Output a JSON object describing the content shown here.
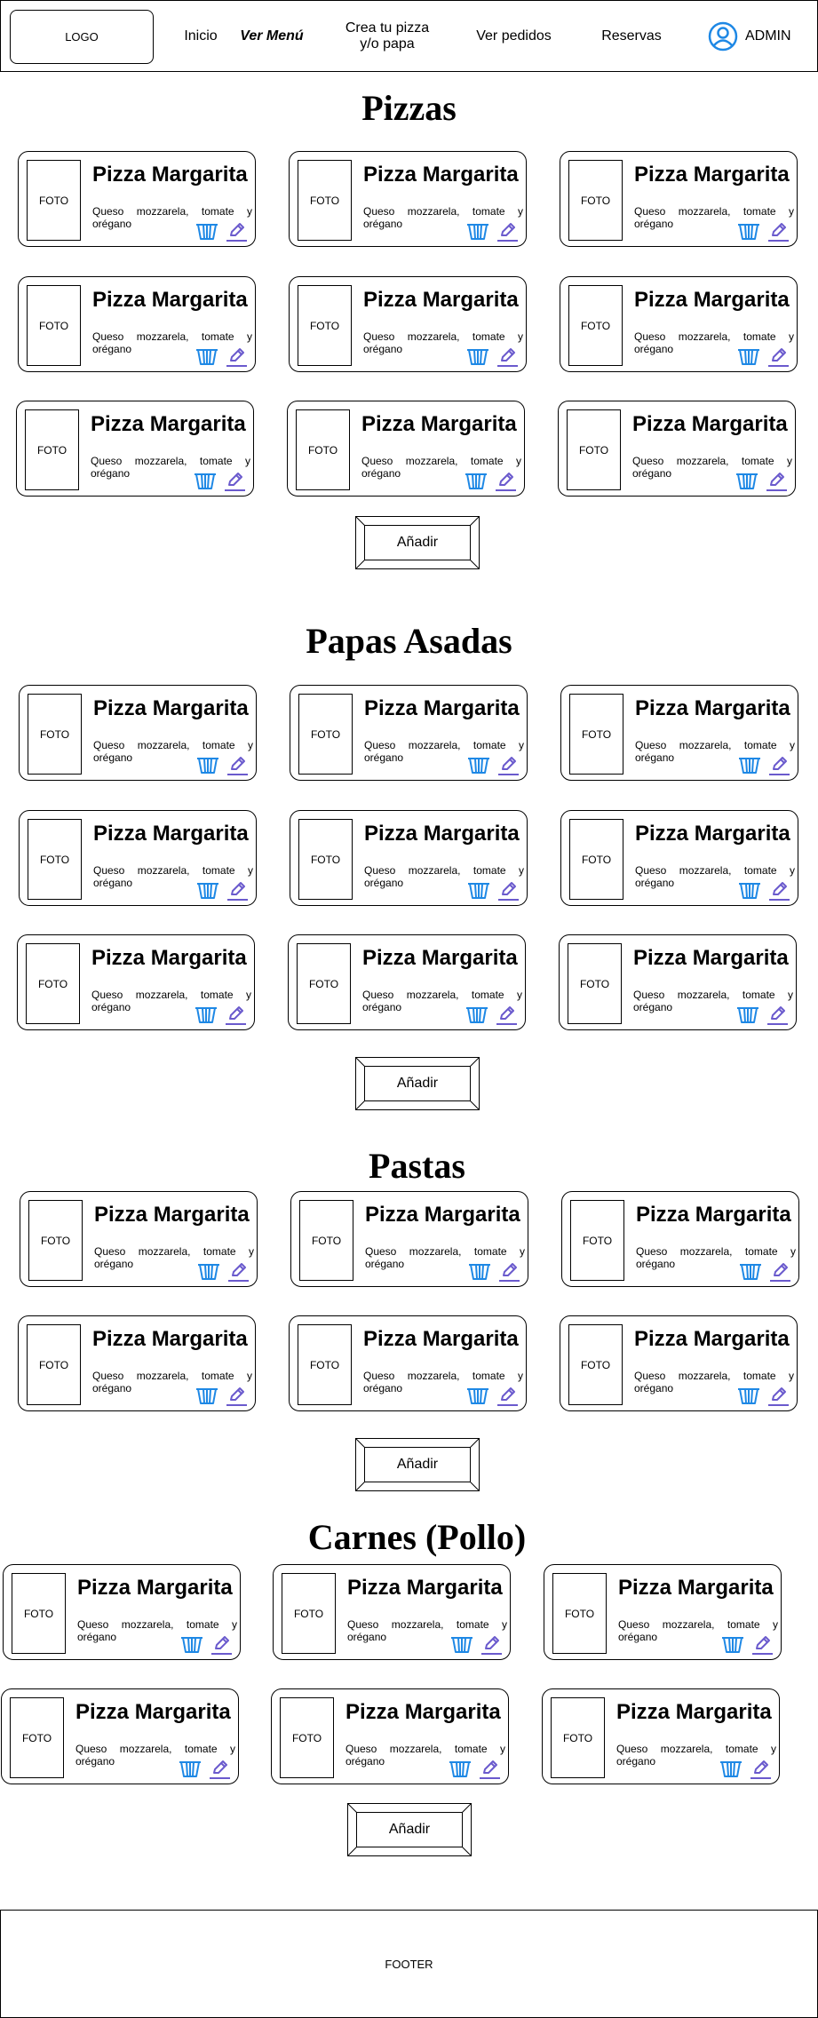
{
  "header": {
    "logo": "LOGO",
    "nav": [
      {
        "label": "Inicio"
      },
      {
        "label": "Ver Menú"
      },
      {
        "label": "Crea tu pizza y/o papa"
      },
      {
        "label": "Ver pedidos"
      },
      {
        "label": "Reservas"
      }
    ],
    "admin_label": "ADMIN",
    "admin_icon": "user-circle-icon"
  },
  "sections": [
    {
      "title": "Pizzas",
      "add_label": "Añadir",
      "items": [
        {
          "photo": "FOTO",
          "name": "Pizza Margarita",
          "description": "Queso mozzarela, tomate y orégano"
        },
        {
          "photo": "FOTO",
          "name": "Pizza Margarita",
          "description": "Queso mozzarela, tomate y orégano"
        },
        {
          "photo": "FOTO",
          "name": "Pizza Margarita",
          "description": "Queso mozzarela, tomate y orégano"
        },
        {
          "photo": "FOTO",
          "name": "Pizza Margarita",
          "description": "Queso mozzarela, tomate y orégano"
        },
        {
          "photo": "FOTO",
          "name": "Pizza Margarita",
          "description": "Queso mozzarela, tomate y orégano"
        },
        {
          "photo": "FOTO",
          "name": "Pizza Margarita",
          "description": "Queso mozzarela, tomate y orégano"
        },
        {
          "photo": "FOTO",
          "name": "Pizza Margarita",
          "description": "Queso mozzarela, tomate y orégano"
        },
        {
          "photo": "FOTO",
          "name": "Pizza Margarita",
          "description": "Queso mozzarela, tomate y orégano"
        },
        {
          "photo": "FOTO",
          "name": "Pizza Margarita",
          "description": "Queso mozzarela, tomate y orégano"
        }
      ]
    },
    {
      "title": "Papas Asadas",
      "add_label": "Añadir",
      "items": [
        {
          "photo": "FOTO",
          "name": "Pizza Margarita",
          "description": "Queso mozzarela, tomate y orégano"
        },
        {
          "photo": "FOTO",
          "name": "Pizza Margarita",
          "description": "Queso mozzarela, tomate y orégano"
        },
        {
          "photo": "FOTO",
          "name": "Pizza Margarita",
          "description": "Queso mozzarela, tomate y orégano"
        },
        {
          "photo": "FOTO",
          "name": "Pizza Margarita",
          "description": "Queso mozzarela, tomate y orégano"
        },
        {
          "photo": "FOTO",
          "name": "Pizza Margarita",
          "description": "Queso mozzarela, tomate y orégano"
        },
        {
          "photo": "FOTO",
          "name": "Pizza Margarita",
          "description": "Queso mozzarela, tomate y orégano"
        },
        {
          "photo": "FOTO",
          "name": "Pizza Margarita",
          "description": "Queso mozzarela, tomate y orégano"
        },
        {
          "photo": "FOTO",
          "name": "Pizza Margarita",
          "description": "Queso mozzarela, tomate y orégano"
        },
        {
          "photo": "FOTO",
          "name": "Pizza Margarita",
          "description": "Queso mozzarela, tomate y orégano"
        }
      ]
    },
    {
      "title": "Pastas",
      "add_label": "Añadir",
      "items": [
        {
          "photo": "FOTO",
          "name": "Pizza Margarita",
          "description": "Queso mozzarela, tomate y orégano"
        },
        {
          "photo": "FOTO",
          "name": "Pizza Margarita",
          "description": "Queso mozzarela, tomate y orégano"
        },
        {
          "photo": "FOTO",
          "name": "Pizza Margarita",
          "description": "Queso mozzarela, tomate y orégano"
        },
        {
          "photo": "FOTO",
          "name": "Pizza Margarita",
          "description": "Queso mozzarela, tomate y orégano"
        },
        {
          "photo": "FOTO",
          "name": "Pizza Margarita",
          "description": "Queso mozzarela, tomate y orégano"
        },
        {
          "photo": "FOTO",
          "name": "Pizza Margarita",
          "description": "Queso mozzarela, tomate y orégano"
        }
      ]
    },
    {
      "title": "Carnes (Pollo)",
      "add_label": "Añadir",
      "items": [
        {
          "photo": "FOTO",
          "name": "Pizza Margarita",
          "description": "Queso mozzarela, tomate y orégano"
        },
        {
          "photo": "FOTO",
          "name": "Pizza Margarita",
          "description": "Queso mozzarela, tomate y orégano"
        },
        {
          "photo": "FOTO",
          "name": "Pizza Margarita",
          "description": "Queso mozzarela, tomate y orégano"
        },
        {
          "photo": "FOTO",
          "name": "Pizza Margarita",
          "description": "Queso mozzarela, tomate y orégano"
        },
        {
          "photo": "FOTO",
          "name": "Pizza Margarita",
          "description": "Queso mozzarela, tomate y orégano"
        },
        {
          "photo": "FOTO",
          "name": "Pizza Margarita",
          "description": "Queso mozzarela, tomate y orégano"
        }
      ]
    }
  ],
  "icons": {
    "delete": "basket-icon",
    "edit": "pencil-icon"
  },
  "colors": {
    "delete_icon": "#1e88e5",
    "edit_icon": "#6a5acd",
    "admin_icon": "#1e88e5"
  },
  "footer": {
    "label": "FOOTER"
  }
}
